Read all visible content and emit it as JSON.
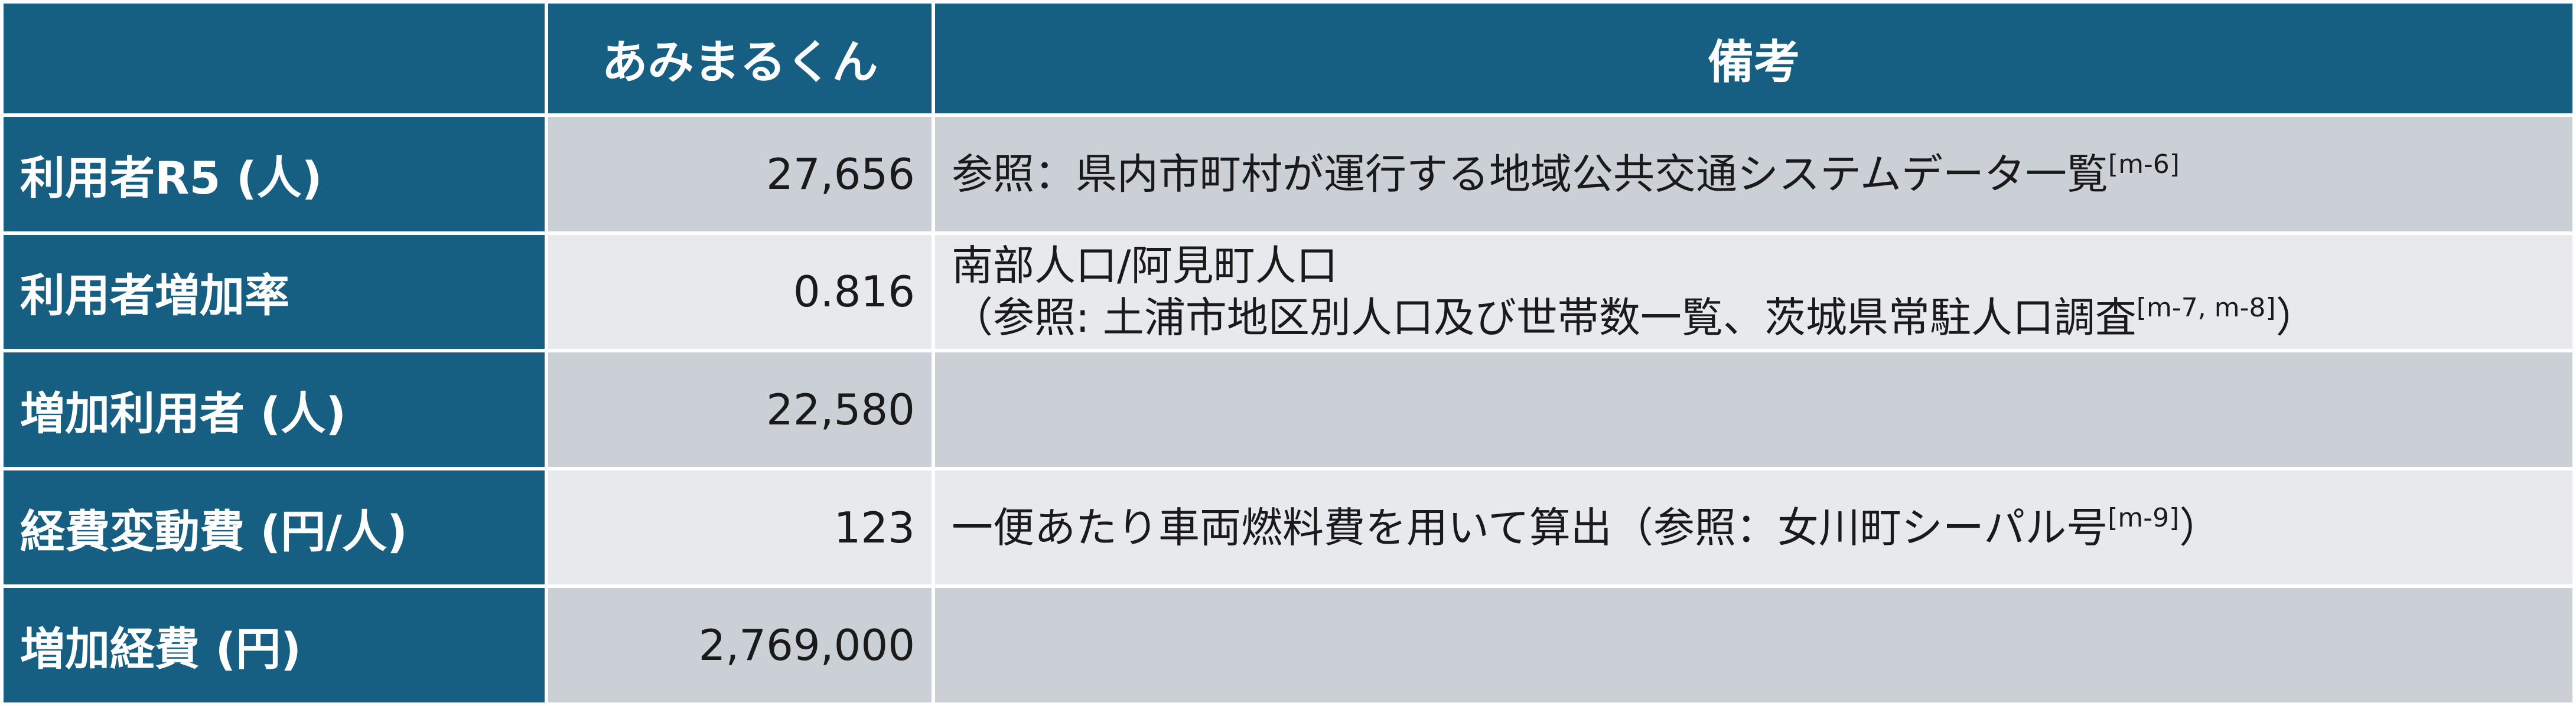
{
  "header": {
    "corner": "",
    "col_value": "あみまるくん",
    "col_note": "備考"
  },
  "rows": [
    {
      "label": "利用者R5 (人)",
      "value": "27,656",
      "note_lines": [
        {
          "text": "参照：県内市町村が運行する地域公共交通システムデータ一覧",
          "ref": "[m-6]",
          "suffix": ""
        }
      ]
    },
    {
      "label": "利用者増加率",
      "value": "0.816",
      "note_lines": [
        {
          "text": "南部人口/阿見町人口",
          "ref": "",
          "suffix": ""
        },
        {
          "text": "（参照: 土浦市地区別人口及び世帯数一覧、茨城県常駐人口調査",
          "ref": "[m-7, m-8]",
          "suffix": "）"
        }
      ]
    },
    {
      "label": "増加利用者 (人)",
      "value": "22,580",
      "note_lines": []
    },
    {
      "label": "経費変動費 (円/人)",
      "value": "123",
      "note_lines": [
        {
          "text": "一便あたり車両燃料費を用いて算出（参照：女川町シーパル号",
          "ref": "[m-9]",
          "suffix": "）"
        }
      ]
    },
    {
      "label": "増加経費 (円)",
      "value": "2,769,000",
      "note_lines": []
    }
  ],
  "colors": {
    "header_bg": "#165f82",
    "row_odd_bg": "#cbcfd6",
    "row_even_bg": "#e7e9ed",
    "text": "#1a1a1a"
  }
}
